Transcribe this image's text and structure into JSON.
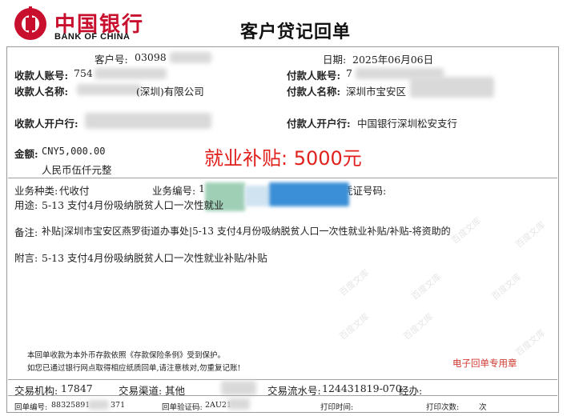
{
  "bank": {
    "name_cn": "中国银行",
    "name_en": "BANK OF CHINA"
  },
  "title": "客户贷记回单",
  "customer_no": {
    "label": "客户号:",
    "value": "03098"
  },
  "date": {
    "label": "日期:",
    "value": "2025年06月06日"
  },
  "payee_account": {
    "label": "收款人账号:",
    "value": "754"
  },
  "payer_account": {
    "label": "付款人账号:",
    "value": "7"
  },
  "payee_name": {
    "label": "收款人名称:",
    "value": "(深圳)有限公司"
  },
  "payer_name": {
    "label": "付款人名称:",
    "value": "深圳市宝安区"
  },
  "payee_bank": {
    "label": "收款人开户行:"
  },
  "payer_bank": {
    "label": "付款人开户行:",
    "value": "中国银行深圳松安支行"
  },
  "amount": {
    "label": "金额:",
    "value": "CNY5,000.00",
    "words": "人民币伍仟元整"
  },
  "annotation": "就业补贴:  5000元",
  "business_type": {
    "label": "业务种类:",
    "value": "代收付"
  },
  "business_no": {
    "label": "业务编号:",
    "value": "1"
  },
  "voucher_no": {
    "label": "凭证号码:"
  },
  "purpose": {
    "label": "用途:",
    "value": "5-13 支付4月份吸纳脱贫人口一次性就业"
  },
  "remark": {
    "label": "备注:",
    "value": "补贴|深圳市宝安区燕罗街道办事处|5-13 支付4月份吸纳脱贫人口一次性就业补贴/补贴-将资助的"
  },
  "postscript": {
    "label": "附言:",
    "value": "5-13 支付4月份吸纳脱贫人口一次性就业补贴/补贴"
  },
  "notice_line1": "本回单收款为本外币存款依照《存款保险条例》受到保护。",
  "notice_line2": "如您已通过银行网点取得相应纸质回单,请注意核对,勿重复记账!",
  "stamp_label": "电子回单专用章",
  "trans_org": {
    "label": "交易机构:",
    "value": "17847"
  },
  "trans_channel": {
    "label": "交易渠道:",
    "value": "其他"
  },
  "trans_serial": {
    "label": "交易流水号:",
    "value": "124431819-070"
  },
  "handler": {
    "label": "经办:"
  },
  "receipt_no": {
    "label": "回单编号:",
    "value": "88325891",
    "tail": "371"
  },
  "verify_code": {
    "label": "回单验证码:",
    "value": "2AU21"
  },
  "print_time": {
    "label": "打印时间:"
  },
  "print_count": {
    "label": "打印次数:",
    "value": "次"
  },
  "watermark": "百度文库"
}
